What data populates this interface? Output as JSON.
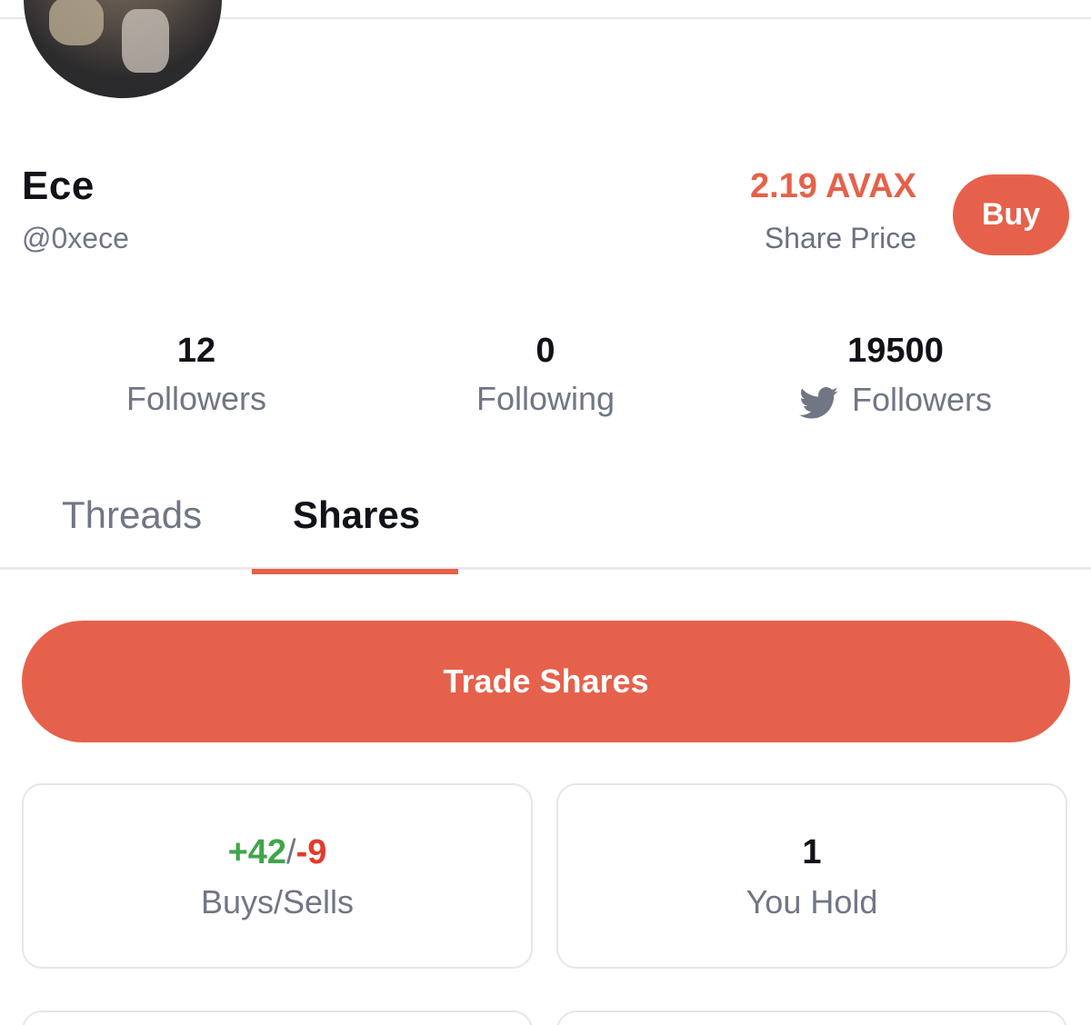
{
  "profile": {
    "name": "Ece",
    "handle": "@0xece",
    "share_price": "2.19 AVAX",
    "share_price_label": "Share Price",
    "buy_label": "Buy"
  },
  "stats": {
    "followers": {
      "value": "12",
      "label": "Followers"
    },
    "following": {
      "value": "0",
      "label": "Following"
    },
    "twitter_followers": {
      "value": "19500",
      "label": "Followers",
      "icon": "twitter-bird-icon"
    }
  },
  "tabs": [
    {
      "label": "Threads",
      "active": false
    },
    {
      "label": "Shares",
      "active": true
    }
  ],
  "trade_button_label": "Trade Shares",
  "cards": {
    "buys_sells": {
      "buys": "+42",
      "separator": "/",
      "sells": "-9",
      "label": "Buys/Sells"
    },
    "you_hold": {
      "value": "1",
      "label": "You Hold"
    }
  },
  "colors": {
    "accent": "#e6614b",
    "buys_green": "#3fa649",
    "sells_red": "#e23a2c",
    "muted_text": "#707684"
  }
}
